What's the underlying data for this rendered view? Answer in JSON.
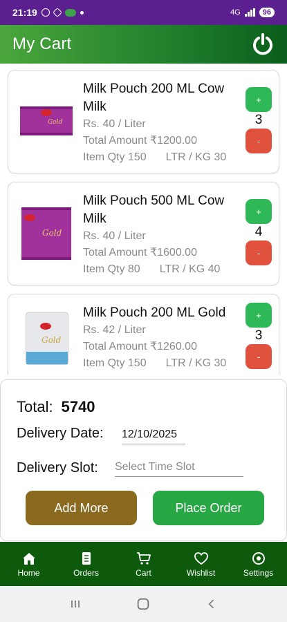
{
  "status_bar": {
    "time": "21:19",
    "battery": "96",
    "network_label": "4G"
  },
  "app_bar": {
    "title": "My Cart",
    "power_icon": "power-icon"
  },
  "cart_items": [
    {
      "name": "Milk Pouch 200 ML Cow Milk",
      "price": "Rs. 40 / Liter",
      "total": "Total Amount ₹1200.00",
      "item_qty": "Item Qty 150",
      "ltr_kg": "LTR / KG 30",
      "quantity": "3",
      "plus": "+",
      "minus": "-",
      "image_color": "#a1319b"
    },
    {
      "name": "Milk Pouch 500 ML Cow Milk",
      "price": "Rs. 40 / Liter",
      "total": "Total Amount ₹1600.00",
      "item_qty": "Item Qty 80",
      "ltr_kg": "LTR / KG 40",
      "quantity": "4",
      "plus": "+",
      "minus": "-",
      "image_color": "#a1319b"
    },
    {
      "name": "Milk Pouch 200 ML Gold",
      "price": "Rs. 42 / Liter",
      "total": "Total Amount ₹1260.00",
      "item_qty": "Item Qty 150",
      "ltr_kg": "LTR / KG 30",
      "quantity": "3",
      "plus": "+",
      "minus": "-",
      "image_color": "#5aa9d6"
    }
  ],
  "summary": {
    "total_label": "Total:",
    "total_value": "5740",
    "delivery_date_label": "Delivery Date:",
    "delivery_date_value": "12/10/2025",
    "delivery_slot_label": "Delivery Slot:",
    "delivery_slot_placeholder": "Select Time Slot",
    "add_more_label": "Add More",
    "place_order_label": "Place Order"
  },
  "bottom_nav": [
    {
      "label": "Home",
      "icon": "home-icon"
    },
    {
      "label": "Orders",
      "icon": "orders-icon"
    },
    {
      "label": "Cart",
      "icon": "cart-icon"
    },
    {
      "label": "Wishlist",
      "icon": "heart-icon"
    },
    {
      "label": "Settings",
      "icon": "settings-icon"
    }
  ],
  "colors": {
    "status_bar": "#5b1f8f",
    "app_bar_start": "#4aa63c",
    "app_bar_end": "#0c5d1b",
    "plus_button": "#2fb857",
    "minus_button": "#e0523d",
    "add_more": "#8b6a1f",
    "place_order": "#27a844",
    "bottom_nav": "#0d5a0d"
  }
}
